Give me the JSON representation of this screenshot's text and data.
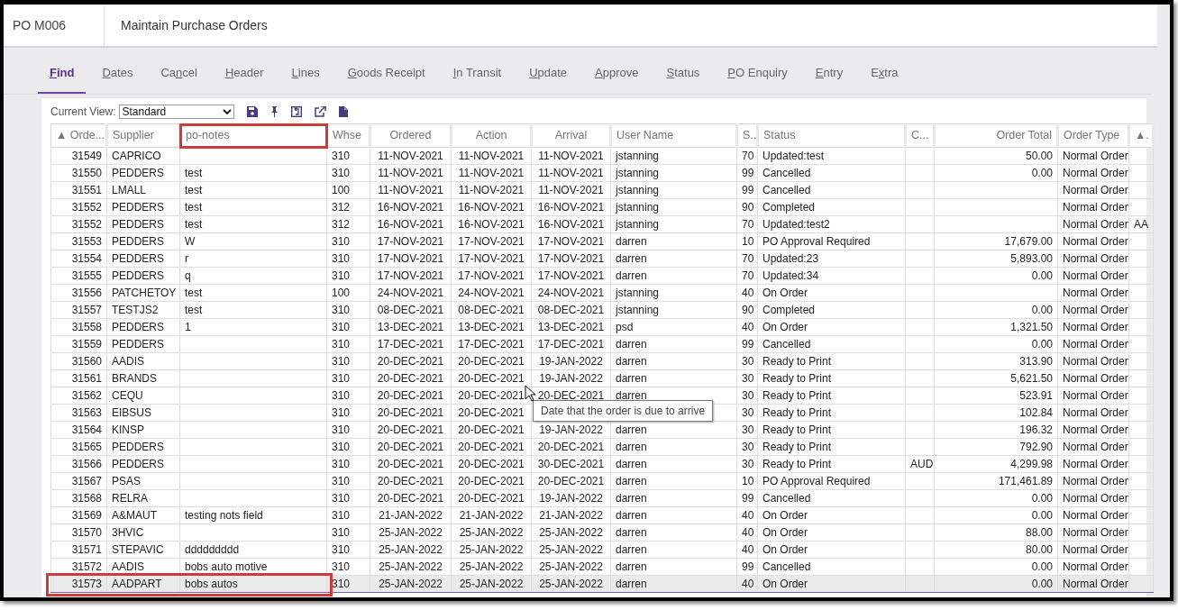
{
  "header": {
    "code": "PO M006",
    "title": "Maintain Purchase Orders"
  },
  "tabs": [
    {
      "access_key": "F",
      "after": "ind",
      "selected": true
    },
    {
      "access_key": "D",
      "after": "ates",
      "selected": false
    },
    {
      "before": "Ca",
      "access_key": "n",
      "after": "cel",
      "selected": false
    },
    {
      "access_key": "H",
      "after": "eader",
      "selected": false
    },
    {
      "access_key": "L",
      "after": "ines",
      "selected": false
    },
    {
      "access_key": "G",
      "after": "oods Receipt",
      "selected": false
    },
    {
      "access_key": "I",
      "after": "n Transit",
      "selected": false
    },
    {
      "access_key": "U",
      "after": "pdate",
      "selected": false
    },
    {
      "access_key": "A",
      "after": "pprove",
      "selected": false
    },
    {
      "access_key": "S",
      "after": "tatus",
      "selected": false
    },
    {
      "access_key": "P",
      "after": "O Enquiry",
      "selected": false
    },
    {
      "access_key": "E",
      "after": "ntry",
      "selected": false
    },
    {
      "before": "E",
      "access_key": "x",
      "after": "tra",
      "selected": false
    }
  ],
  "view": {
    "label": "Current View:",
    "value": "Standard"
  },
  "table": {
    "columns": [
      {
        "label": "▲ Orde...",
        "highlighted": false
      },
      {
        "label": "Supplier",
        "highlighted": false
      },
      {
        "label": "po-notes",
        "highlighted": true
      },
      {
        "label": "Whse",
        "highlighted": false
      },
      {
        "label": "Ordered",
        "highlighted": false
      },
      {
        "label": "Action",
        "highlighted": false
      },
      {
        "label": "Arrival",
        "highlighted": false
      },
      {
        "label": "User Name",
        "highlighted": false
      },
      {
        "label": "S..",
        "highlighted": false
      },
      {
        "label": "Status",
        "highlighted": false
      },
      {
        "label": "C...",
        "highlighted": false
      },
      {
        "label": "Order Total",
        "highlighted": false
      },
      {
        "label": "Order Type",
        "highlighted": false
      },
      {
        "label": "▲.",
        "highlighted": false
      }
    ],
    "rows": [
      {
        "cells": [
          "31549",
          "CAPRICO",
          null,
          "310",
          "11-NOV-2021",
          "11-NOV-2021",
          "11-NOV-2021",
          "jstanning",
          "70",
          "Updated:test",
          null,
          "50.00",
          "Normal Order",
          null
        ],
        "selected": false,
        "highlighted": false
      },
      {
        "cells": [
          "31550",
          "PEDDERS",
          "test",
          "310",
          "11-NOV-2021",
          "11-NOV-2021",
          "11-NOV-2021",
          "jstanning",
          "99",
          "Cancelled",
          null,
          "0.00",
          "Normal Order",
          null
        ],
        "selected": false,
        "highlighted": false
      },
      {
        "cells": [
          "31551",
          "LMALL",
          "test",
          "100",
          "11-NOV-2021",
          "11-NOV-2021",
          "11-NOV-2021",
          "jstanning",
          "99",
          "Cancelled",
          null,
          null,
          "Normal Order",
          null
        ],
        "selected": false,
        "highlighted": false
      },
      {
        "cells": [
          "31552",
          "PEDDERS",
          "test",
          "312",
          "16-NOV-2021",
          "16-NOV-2021",
          "16-NOV-2021",
          "jstanning",
          "90",
          "Completed",
          null,
          null,
          "Normal Order",
          null
        ],
        "selected": false,
        "highlighted": false
      },
      {
        "cells": [
          "31552",
          "PEDDERS",
          "test",
          "312",
          "16-NOV-2021",
          "16-NOV-2021",
          "16-NOV-2021",
          "jstanning",
          "70",
          "Updated:test2",
          null,
          null,
          "Normal Order",
          "AA"
        ],
        "selected": false,
        "highlighted": false
      },
      {
        "cells": [
          "31553",
          "PEDDERS",
          "W",
          "310",
          "17-NOV-2021",
          "17-NOV-2021",
          "17-NOV-2021",
          "darren",
          "10",
          "PO Approval Required",
          null,
          "17,679.00",
          "Normal Order",
          null
        ],
        "selected": false,
        "highlighted": false
      },
      {
        "cells": [
          "31554",
          "PEDDERS",
          "r",
          "310",
          "17-NOV-2021",
          "17-NOV-2021",
          "17-NOV-2021",
          "darren",
          "70",
          "Updated:23",
          null,
          "5,893.00",
          "Normal Order",
          null
        ],
        "selected": false,
        "highlighted": false
      },
      {
        "cells": [
          "31555",
          "PEDDERS",
          "q",
          "310",
          "17-NOV-2021",
          "17-NOV-2021",
          "17-NOV-2021",
          "darren",
          "70",
          "Updated:34",
          null,
          "0.00",
          "Normal Order",
          null
        ],
        "selected": false,
        "highlighted": false
      },
      {
        "cells": [
          "31556",
          "PATCHETOY",
          "test",
          "100",
          "24-NOV-2021",
          "24-NOV-2021",
          "24-NOV-2021",
          "jstanning",
          "40",
          "On Order",
          null,
          null,
          "Normal Order",
          null
        ],
        "selected": false,
        "highlighted": false
      },
      {
        "cells": [
          "31557",
          "TESTJS2",
          "test",
          "310",
          "08-DEC-2021",
          "08-DEC-2021",
          "08-DEC-2021",
          "jstanning",
          "90",
          "Completed",
          null,
          "0.00",
          "Normal Order",
          null
        ],
        "selected": false,
        "highlighted": false
      },
      {
        "cells": [
          "31558",
          "PEDDERS",
          "1",
          "310",
          "13-DEC-2021",
          "13-DEC-2021",
          "13-DEC-2021",
          "psd",
          "40",
          "On Order",
          null,
          "1,321.50",
          "Normal Order",
          null
        ],
        "selected": false,
        "highlighted": false
      },
      {
        "cells": [
          "31559",
          "PEDDERS",
          null,
          "310",
          "17-DEC-2021",
          "17-DEC-2021",
          "17-DEC-2021",
          "darren",
          "99",
          "Cancelled",
          null,
          "0.00",
          "Normal Order",
          null
        ],
        "selected": false,
        "highlighted": false
      },
      {
        "cells": [
          "31560",
          "AADIS",
          null,
          "310",
          "20-DEC-2021",
          "20-DEC-2021",
          "19-JAN-2022",
          "darren",
          "30",
          "Ready to Print",
          null,
          "313.90",
          "Normal Order",
          null
        ],
        "selected": false,
        "highlighted": false
      },
      {
        "cells": [
          "31561",
          "BRANDS",
          null,
          "310",
          "20-DEC-2021",
          "20-DEC-2021",
          "19-JAN-2022",
          "darren",
          "30",
          "Ready to Print",
          null,
          "5,621.50",
          "Normal Order",
          null
        ],
        "selected": false,
        "highlighted": false
      },
      {
        "cells": [
          "31562",
          "CEQU",
          null,
          "310",
          "20-DEC-2021",
          "20-DEC-2021",
          "20-DEC-2021",
          "darren",
          "30",
          "Ready to Print",
          null,
          "523.91",
          "Normal Order",
          null
        ],
        "selected": false,
        "highlighted": false
      },
      {
        "cells": [
          "31563",
          "EIBSUS",
          null,
          "310",
          "20-DEC-2021",
          "20-DEC-2021",
          null,
          null,
          "30",
          "Ready to Print",
          null,
          "102.84",
          "Normal Order",
          null
        ],
        "selected": false,
        "highlighted": false
      },
      {
        "cells": [
          "31564",
          "KINSP",
          null,
          "310",
          "20-DEC-2021",
          "20-DEC-2021",
          "19-JAN-2022",
          "darren",
          "30",
          "Ready to Print",
          null,
          "196.32",
          "Normal Order",
          null
        ],
        "selected": false,
        "highlighted": false
      },
      {
        "cells": [
          "31565",
          "PEDDERS",
          null,
          "310",
          "20-DEC-2021",
          "20-DEC-2021",
          "20-DEC-2021",
          "darren",
          "30",
          "Ready to Print",
          null,
          "792.90",
          "Normal Order",
          null
        ],
        "selected": false,
        "highlighted": false
      },
      {
        "cells": [
          "31566",
          "PEDDERS",
          null,
          "310",
          "20-DEC-2021",
          "20-DEC-2021",
          "30-DEC-2021",
          "darren",
          "30",
          "Ready to Print",
          "AUD",
          "4,299.98",
          "Normal Order",
          null
        ],
        "selected": false,
        "highlighted": false
      },
      {
        "cells": [
          "31567",
          "PSAS",
          null,
          "310",
          "20-DEC-2021",
          "20-DEC-2021",
          "20-DEC-2021",
          "darren",
          "10",
          "PO Approval Required",
          null,
          "171,461.89",
          "Normal Order",
          null
        ],
        "selected": false,
        "highlighted": false
      },
      {
        "cells": [
          "31568",
          "RELRA",
          null,
          "310",
          "20-DEC-2021",
          "20-DEC-2021",
          "19-JAN-2022",
          "darren",
          "99",
          "Cancelled",
          null,
          "0.00",
          "Normal Order",
          null
        ],
        "selected": false,
        "highlighted": false
      },
      {
        "cells": [
          "31569",
          "A&MAUT",
          "testing nots field",
          "310",
          "21-JAN-2022",
          "21-JAN-2022",
          "21-JAN-2022",
          "darren",
          "40",
          "On Order",
          null,
          "0.00",
          "Normal Order",
          null
        ],
        "selected": false,
        "highlighted": false
      },
      {
        "cells": [
          "31570",
          "3HVIC",
          null,
          "310",
          "25-JAN-2022",
          "25-JAN-2022",
          "25-JAN-2022",
          "darren",
          "40",
          "On Order",
          null,
          "88.00",
          "Normal Order",
          null
        ],
        "selected": false,
        "highlighted": false
      },
      {
        "cells": [
          "31571",
          "STEPAVIC",
          "ddddddddd",
          "310",
          "25-JAN-2022",
          "25-JAN-2022",
          "25-JAN-2022",
          "darren",
          "40",
          "On Order",
          null,
          "80.00",
          "Normal Order",
          null
        ],
        "selected": false,
        "highlighted": false
      },
      {
        "cells": [
          "31572",
          "AADIS",
          "bobs auto motive",
          "310",
          "25-JAN-2022",
          "25-JAN-2022",
          "25-JAN-2022",
          "darren",
          "99",
          "Cancelled",
          null,
          "0.00",
          "Normal Order",
          null
        ],
        "selected": false,
        "highlighted": false
      },
      {
        "cells": [
          "31573",
          "AADPART",
          "bobs autos",
          "310",
          "25-JAN-2022",
          "25-JAN-2022",
          "25-JAN-2022",
          "darren",
          "40",
          "On Order",
          null,
          "0.00",
          "Normal Order",
          null
        ],
        "selected": true,
        "highlighted": true
      }
    ]
  },
  "tooltip": {
    "text": "Date that the order is due to arrive"
  }
}
